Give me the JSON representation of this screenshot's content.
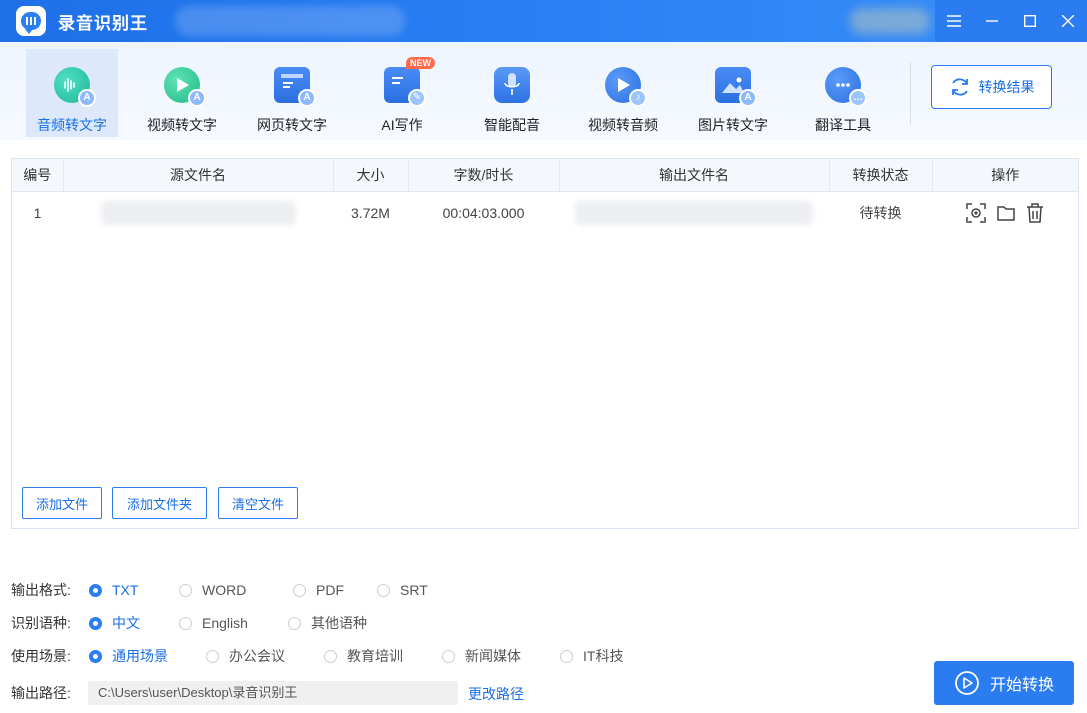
{
  "app": {
    "title": "录音识别王"
  },
  "toolbar": {
    "tools": [
      {
        "label": "音频转文字",
        "icon": "audio-to-text-icon",
        "active": true
      },
      {
        "label": "视频转文字",
        "icon": "video-to-text-icon",
        "active": false
      },
      {
        "label": "网页转文字",
        "icon": "webpage-to-text-icon",
        "active": false
      },
      {
        "label": "AI写作",
        "icon": "ai-writing-icon",
        "active": false,
        "badge": "NEW"
      },
      {
        "label": "智能配音",
        "icon": "smart-dubbing-icon",
        "active": false
      },
      {
        "label": "视频转音频",
        "icon": "video-to-audio-icon",
        "active": false
      },
      {
        "label": "图片转文字",
        "icon": "image-to-text-icon",
        "active": false
      },
      {
        "label": "翻译工具",
        "icon": "translate-icon",
        "active": false
      }
    ],
    "result_label": "转换结果"
  },
  "table": {
    "headers": [
      "编号",
      "源文件名",
      "大小",
      "字数/时长",
      "输出文件名",
      "转换状态",
      "操作"
    ],
    "rows": [
      {
        "index": "1",
        "size": "3.72M",
        "duration": "00:04:03.000",
        "status": "待转换"
      }
    ]
  },
  "panel_buttons": {
    "add_file": "添加文件",
    "add_folder": "添加文件夹",
    "clear_files": "清空文件"
  },
  "options": {
    "format": {
      "label": "输出格式:",
      "choices": [
        "TXT",
        "WORD",
        "PDF",
        "SRT"
      ],
      "selected": "TXT"
    },
    "language": {
      "label": "识别语种:",
      "choices": [
        "中文",
        "English",
        "其他语种"
      ],
      "selected": "中文"
    },
    "scene": {
      "label": "使用场景:",
      "choices": [
        "通用场景",
        "办公会议",
        "教育培训",
        "新闻媒体",
        "IT科技"
      ],
      "selected": "通用场景"
    },
    "output_path": {
      "label": "输出路径:",
      "value": "C:\\Users\\user\\Desktop\\录音识别王",
      "change_label": "更改路径"
    }
  },
  "start_label": "开始转换",
  "colors": {
    "accent": "#2a7cf0",
    "titlebar": "#1e6fe8"
  }
}
